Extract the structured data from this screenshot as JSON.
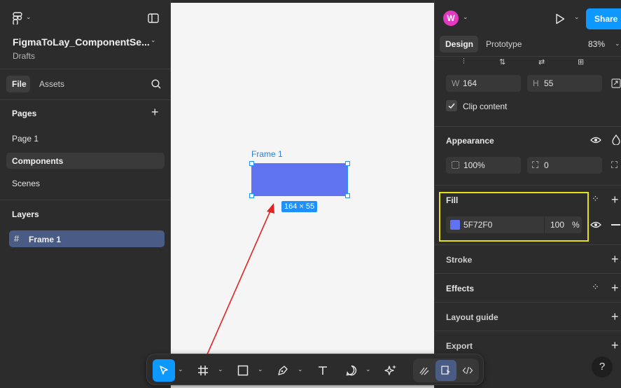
{
  "left": {
    "file_name": "FigmaToLay_ComponentSe...",
    "location": "Drafts",
    "tabs": {
      "file": "File",
      "assets": "Assets"
    },
    "pages_title": "Pages",
    "pages": [
      "Page 1",
      "Components",
      "Scenes"
    ],
    "layers_title": "Layers",
    "layer": "Frame 1"
  },
  "canvas": {
    "frame_label": "Frame 1",
    "size_badge": "164 × 55",
    "fill_color": "#5f72f0"
  },
  "header": {
    "avatar_letter": "W",
    "share_label": "Share",
    "tabs": {
      "design": "Design",
      "prototype": "Prototype"
    },
    "zoom": "83%"
  },
  "frame_props": {
    "w_label": "W",
    "w_value": "164",
    "h_label": "H",
    "h_value": "55",
    "clip_content_label": "Clip content"
  },
  "appearance": {
    "title": "Appearance",
    "opacity": "100%",
    "radius": "0"
  },
  "fill": {
    "title": "Fill",
    "hex": "5F72F0",
    "opacity": "100",
    "percent": "%",
    "swatch_color": "#5f72f0"
  },
  "sections": {
    "stroke": "Stroke",
    "effects": "Effects",
    "layout_guide": "Layout guide",
    "export": "Export"
  },
  "help": "?"
}
